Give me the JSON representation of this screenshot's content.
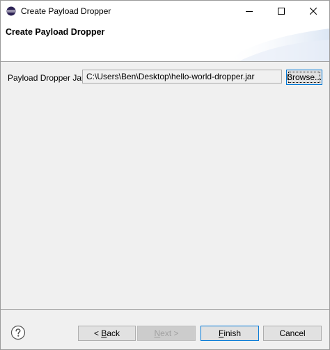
{
  "window": {
    "title": "Create Payload Dropper",
    "icons": [
      "eclipse-icon",
      "minimize-icon",
      "maximize-icon",
      "close-icon"
    ]
  },
  "header": {
    "title": "Create Payload Dropper"
  },
  "form": {
    "jar_label": "Payload Dropper Jar:",
    "jar_value": "C:\\Users\\Ben\\Desktop\\hello-world-dropper.jar",
    "browse_label": "Browse..."
  },
  "footer": {
    "help_icon": "help-icon",
    "back_prefix": "< ",
    "back_mnemonic": "B",
    "back_rest": "ack",
    "next_mnemonic": "N",
    "next_rest": "ext >",
    "finish_mnemonic": "F",
    "finish_rest": "inish",
    "cancel_label": "Cancel"
  },
  "colors": {
    "accent": "#0078d7",
    "dialog_bg": "#f0f0f0",
    "header_bg": "#ffffff",
    "disabled_text": "#a0a0a0"
  }
}
